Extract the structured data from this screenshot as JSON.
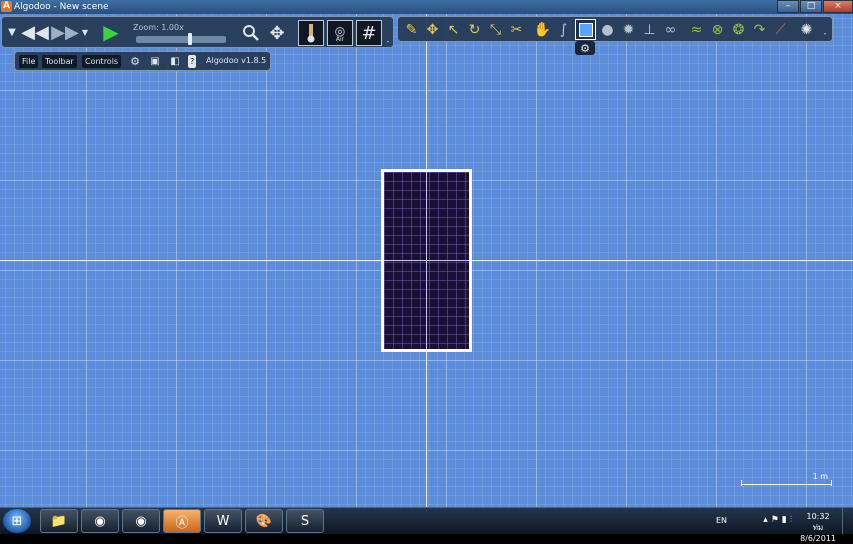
{
  "window": {
    "title": "Algodoo - New scene",
    "app_icon": "A",
    "minimize": "–",
    "maximize": "□",
    "close": "×"
  },
  "toolbar_left": {
    "icons": [
      "chevron-down-icon",
      "rewind-icon",
      "fast-forward-icon",
      "dropdown-icon",
      "play-icon"
    ],
    "zoom_label": "Zoom: 1.00x",
    "zoom_level_fraction": 0.58,
    "tools": [
      "zoom-tool-icon",
      "pan-tool-icon",
      "gravity-icon",
      "air-icon",
      "grid-icon"
    ],
    "air_label": "Air"
  },
  "menu": {
    "file": "File",
    "toolbar": "Toolbar",
    "controls": "Controls",
    "version": "Algodoo v1.8.5",
    "help": "?"
  },
  "toolbar_right": {
    "tools": [
      "sketch",
      "move",
      "drag",
      "rotate",
      "scale",
      "cut",
      "hand",
      "rope",
      "box",
      "circle",
      "gear",
      "plane",
      "chain",
      "spring",
      "fixate",
      "axle",
      "wheel",
      "hinge",
      "laser",
      "tracer"
    ],
    "selected_tool": "box"
  },
  "scale_bar": {
    "label": "1 m"
  },
  "taskbar": {
    "apps": [
      "explorer-icon",
      "firefox-icon",
      "firefox-icon",
      "algodoo-icon",
      "word-icon",
      "paint-icon",
      "skype-icon"
    ],
    "language": "EN",
    "time": "10:32 ท่ม",
    "date": "8/6/2011"
  },
  "colors": {
    "canvas": "#5b8ddb",
    "box_fill": "#1a1036",
    "box_border": "#ffffff",
    "selected_tool": "#5aa5ff"
  }
}
